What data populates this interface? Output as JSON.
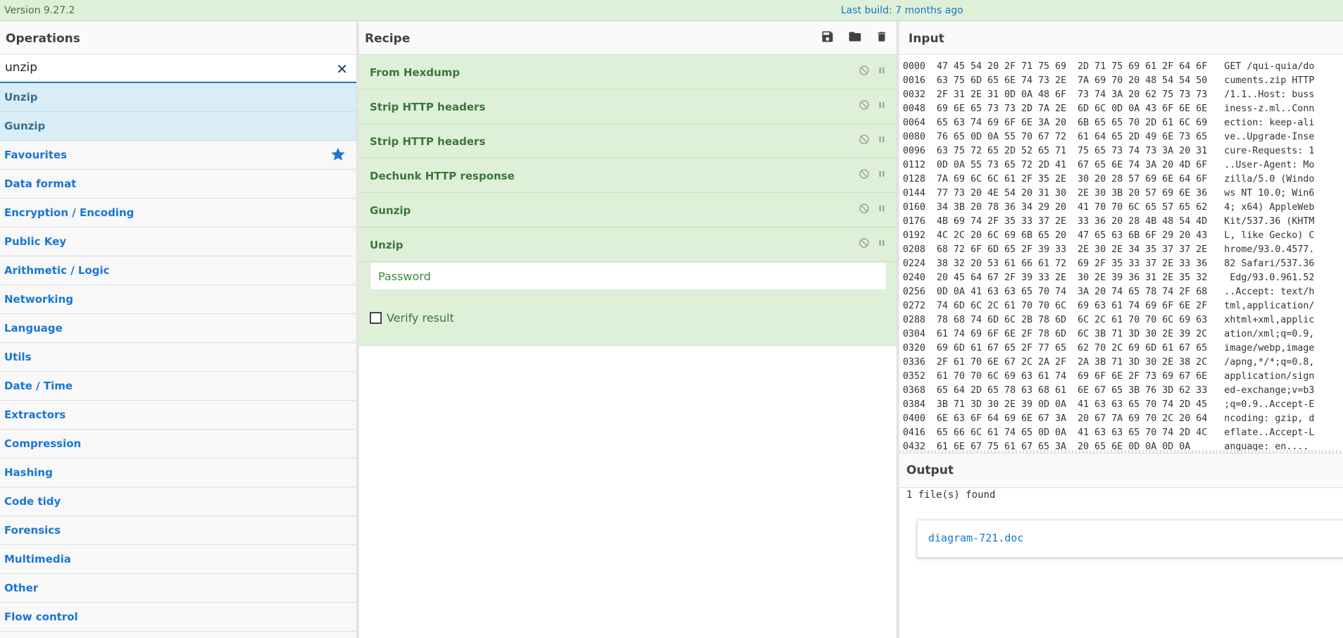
{
  "banner": {
    "version": "Version 9.27.2",
    "last_build": "Last build: 7 months ago"
  },
  "operations": {
    "title": "Operations",
    "search_value": "unzip",
    "results": [
      "Unzip",
      "Gunzip"
    ],
    "categories": [
      "Favourites",
      "Data format",
      "Encryption / Encoding",
      "Public Key",
      "Arithmetic / Logic",
      "Networking",
      "Language",
      "Utils",
      "Date / Time",
      "Extractors",
      "Compression",
      "Hashing",
      "Code tidy",
      "Forensics",
      "Multimedia",
      "Other",
      "Flow control"
    ]
  },
  "recipe": {
    "title": "Recipe",
    "ops": [
      "From Hexdump",
      "Strip HTTP headers",
      "Strip HTTP headers",
      "Dechunk HTTP response",
      "Gunzip",
      "Unzip"
    ],
    "password_placeholder": "Password",
    "verify_label": "Verify result"
  },
  "input": {
    "title": "Input",
    "lines": [
      "0000  47 45 54 20 2F 71 75 69  2D 71 75 69 61 2F 64 6F   GET /qui-quia/do",
      "0016  63 75 6D 65 6E 74 73 2E  7A 69 70 20 48 54 54 50   cuments.zip HTTP",
      "0032  2F 31 2E 31 0D 0A 48 6F  73 74 3A 20 62 75 73 73   /1.1..Host: buss",
      "0048  69 6E 65 73 73 2D 7A 2E  6D 6C 0D 0A 43 6F 6E 6E   iness-z.ml..Conn",
      "0064  65 63 74 69 6F 6E 3A 20  6B 65 65 70 2D 61 6C 69   ection: keep-ali",
      "0080  76 65 0D 0A 55 70 67 72  61 64 65 2D 49 6E 73 65   ve..Upgrade-Inse",
      "0096  63 75 72 65 2D 52 65 71  75 65 73 74 73 3A 20 31   cure-Requests: 1",
      "0112  0D 0A 55 73 65 72 2D 41  67 65 6E 74 3A 20 4D 6F   ..User-Agent: Mo",
      "0128  7A 69 6C 6C 61 2F 35 2E  30 20 28 57 69 6E 64 6F   zilla/5.0 (Windo",
      "0144  77 73 20 4E 54 20 31 30  2E 30 3B 20 57 69 6E 36   ws NT 10.0; Win6",
      "0160  34 3B 20 78 36 34 29 20  41 70 70 6C 65 57 65 62   4; x64) AppleWeb",
      "0176  4B 69 74 2F 35 33 37 2E  33 36 20 28 4B 48 54 4D   Kit/537.36 (KHTM",
      "0192  4C 2C 20 6C 69 6B 65 20  47 65 63 6B 6F 29 20 43   L, like Gecko) C",
      "0208  68 72 6F 6D 65 2F 39 33  2E 30 2E 34 35 37 37 2E   hrome/93.0.4577.",
      "0224  38 32 20 53 61 66 61 72  69 2F 35 33 37 2E 33 36   82 Safari/537.36",
      "0240  20 45 64 67 2F 39 33 2E  30 2E 39 36 31 2E 35 32    Edg/93.0.961.52",
      "0256  0D 0A 41 63 63 65 70 74  3A 20 74 65 78 74 2F 68   ..Accept: text/h",
      "0272  74 6D 6C 2C 61 70 70 6C  69 63 61 74 69 6F 6E 2F   tml,application/",
      "0288  78 68 74 6D 6C 2B 78 6D  6C 2C 61 70 70 6C 69 63   xhtml+xml,applic",
      "0304  61 74 69 6F 6E 2F 78 6D  6C 3B 71 3D 30 2E 39 2C   ation/xml;q=0.9,",
      "0320  69 6D 61 67 65 2F 77 65  62 70 2C 69 6D 61 67 65   image/webp,image",
      "0336  2F 61 70 6E 67 2C 2A 2F  2A 3B 71 3D 30 2E 38 2C   /apng,*/*;q=0.8,",
      "0352  61 70 70 6C 69 63 61 74  69 6F 6E 2F 73 69 67 6E   application/sign",
      "0368  65 64 2D 65 78 63 68 61  6E 67 65 3B 76 3D 62 33   ed-exchange;v=b3",
      "0384  3B 71 3D 30 2E 39 0D 0A  41 63 63 65 70 74 2D 45   ;q=0.9..Accept-E",
      "0400  6E 63 6F 64 69 6E 67 3A  20 67 7A 69 70 2C 20 64   ncoding: gzip, d",
      "0416  65 66 6C 61 74 65 0D 0A  41 63 63 65 70 74 2D 4C   eflate..Accept-L",
      "0432  61 6E 67 75 61 67 65 3A  20 65 6E 0D 0A 0D 0A      anguage: en...."
    ]
  },
  "output": {
    "title": "Output",
    "found": "1 file(s) found",
    "file": "diagram-721.doc"
  }
}
